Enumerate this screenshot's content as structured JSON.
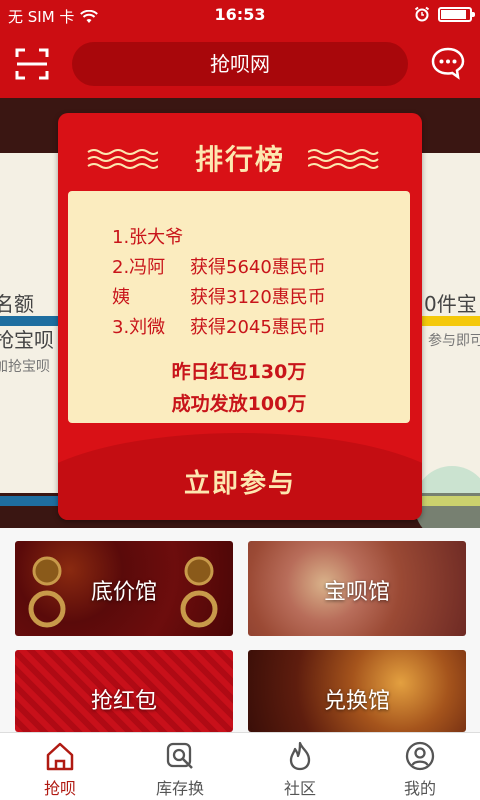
{
  "status_bar": {
    "carrier": "无 SIM 卡",
    "time": "16:53",
    "battery_level": 0.9
  },
  "header": {
    "title": "抢呗网",
    "scan_icon": "scan-icon",
    "chat_icon": "chat-bubble-icon"
  },
  "banner": {
    "left_card": {
      "line1": "名额",
      "line2": "抢宝呗",
      "line3": "加抢宝呗"
    },
    "right_card": {
      "line1": "0件宝",
      "line2": "参与即可"
    }
  },
  "popup": {
    "title": "排行榜",
    "rankings": [
      {
        "name": "1.张大爷",
        "award": ""
      },
      {
        "name": "2.冯阿",
        "award": "获得5640惠民币"
      },
      {
        "name": "姨",
        "award": "获得3120惠民币"
      },
      {
        "name": "3.刘微",
        "award": "获得2045惠民币"
      }
    ],
    "stat_yesterday": "昨日红包130万",
    "stat_released": "成功发放100万",
    "join_label": "立即参与"
  },
  "tiles": [
    {
      "label": "底价馆"
    },
    {
      "label": "宝呗馆"
    },
    {
      "label": "抢红包"
    },
    {
      "label": "兑换馆"
    }
  ],
  "tabbar": {
    "items": [
      {
        "label": "抢呗",
        "icon": "home-icon",
        "active": true
      },
      {
        "label": "库存换",
        "icon": "search-exchange-icon",
        "active": false
      },
      {
        "label": "社区",
        "icon": "fire-icon",
        "active": false
      },
      {
        "label": "我的",
        "icon": "user-icon",
        "active": false
      }
    ]
  },
  "colors": {
    "brand_red": "#cc0d12",
    "popup_red": "#d91116",
    "gold_text": "#fde7b0",
    "rank_box": "#fbecbf",
    "active_tab": "#b01a12"
  }
}
